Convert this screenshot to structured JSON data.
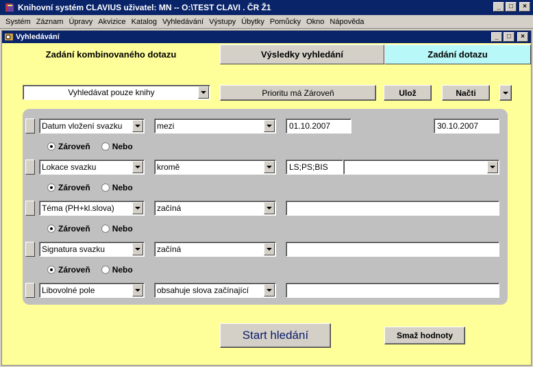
{
  "app": {
    "title": "Knihovní systém CLAVIUS  uživatel: MN -- O:\\TEST CLAVI . ČR Ž1",
    "window_buttons": [
      "_",
      "□",
      "×"
    ]
  },
  "menu": [
    "Systém",
    "Záznam",
    "Úpravy",
    "Akvizice",
    "Katalog",
    "Vyhledávání",
    "Výstupy",
    "Úbytky",
    "Pomůcky",
    "Okno",
    "Nápověda"
  ],
  "child": {
    "title": "Vyhledávání",
    "tabs": [
      "Zadání kombinovaného dotazu",
      "Výsledky vyhledání",
      "Zadání dotazu"
    ],
    "toolbar": {
      "scope_select": "Vyhledávat pouze knihy",
      "priority_button": "Prioritu má Zároveň",
      "save_button": "Ulož",
      "load_button": "Načti"
    },
    "rows": [
      {
        "field": "Datum vložení svazku",
        "operator": "mezi",
        "value": "01.10.2007",
        "value2": "30.10.2007"
      },
      {
        "field": "Lokace svazku",
        "operator": "kromě",
        "value": "LS;PS;BIS",
        "value_select": ""
      },
      {
        "field": "Téma (PH+kl.slova)",
        "operator": "začíná",
        "value": ""
      },
      {
        "field": "Signatura svazku",
        "operator": "začíná",
        "value": ""
      },
      {
        "field": "Libovolné pole",
        "operator": "obsahuje slova začínající",
        "value": ""
      }
    ],
    "connectors": {
      "and": "Zároveň",
      "or": "Nebo"
    },
    "start_button": "Start hledání",
    "clear_button": "Smaž hodnoty"
  },
  "colors": {
    "background": "#ffff99",
    "titlebar": "#0a246a",
    "panel": "#c0c0c0",
    "query_tab": "#b8f8f8"
  }
}
